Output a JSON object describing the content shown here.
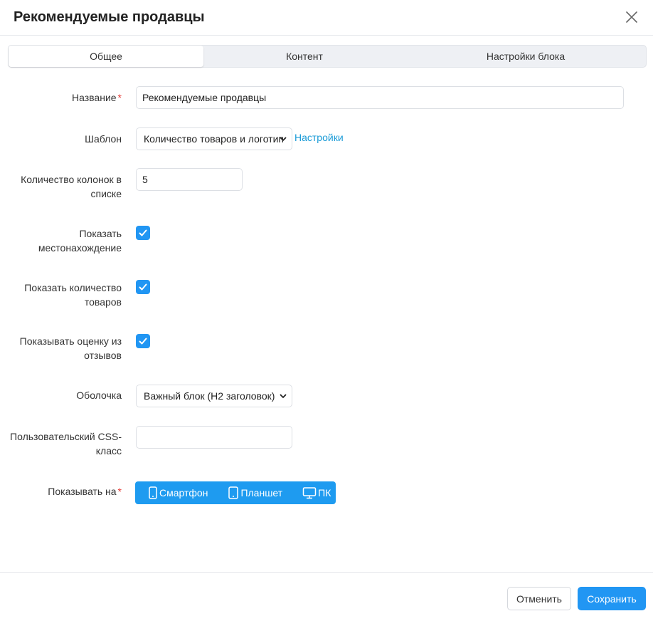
{
  "modal": {
    "title": "Рекомендуемые продавцы"
  },
  "tabs": [
    {
      "label": "Общее",
      "active": true
    },
    {
      "label": "Контент",
      "active": false
    },
    {
      "label": "Настройки блока",
      "active": false
    }
  ],
  "form": {
    "name": {
      "label": "Название",
      "value": "Рекомендуемые продавцы",
      "required": true
    },
    "template": {
      "label": "Шаблон",
      "value": "Количество товаров и логотип",
      "link": "Настройки"
    },
    "columns": {
      "label": "Количество колонок в списке",
      "value": "5"
    },
    "show_location": {
      "label": "Показать местонахождение",
      "checked": true
    },
    "show_products_count": {
      "label": "Показать количество товаров",
      "checked": true
    },
    "show_rating": {
      "label": "Показывать оценку из отзывов",
      "checked": true
    },
    "wrapper": {
      "label": "Оболочка",
      "value": "Важный блок (H2 заголовок)"
    },
    "css_class": {
      "label": "Пользовательский CSS-класс",
      "value": ""
    },
    "show_on": {
      "label": "Показывать на",
      "required": true,
      "options": [
        {
          "label": "Смартфон",
          "icon": "smartphone-icon"
        },
        {
          "label": "Планшет",
          "icon": "tablet-icon"
        },
        {
          "label": "ПК",
          "icon": "desktop-icon"
        }
      ]
    }
  },
  "footer": {
    "cancel_label": "Отменить",
    "save_label": "Сохранить"
  },
  "colors": {
    "accent": "#2196f3",
    "link": "#1a9bd7",
    "required": "#e53935"
  }
}
